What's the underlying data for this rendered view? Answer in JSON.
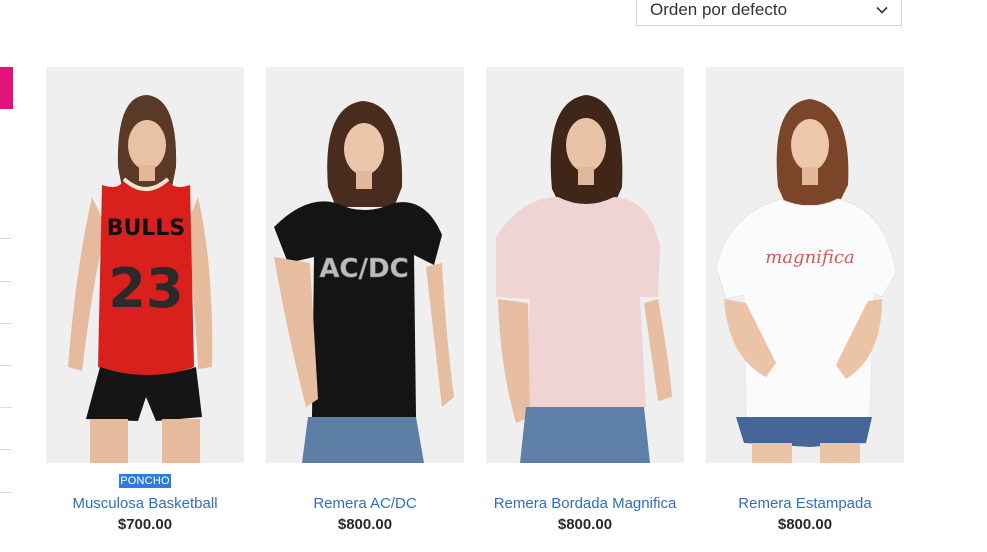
{
  "sort": {
    "selected": "Orden por defecto"
  },
  "colors": {
    "accent": "#e1127a",
    "link": "#2f6fbf",
    "highlight": "#2f7ce0"
  },
  "products": [
    {
      "category": "PONCHO",
      "name": "Musculosa Basketball",
      "price": "$700.00",
      "print_line1": "BULLS",
      "print_line2": "23"
    },
    {
      "category": "",
      "name": "Remera AC/DC",
      "price": "$800.00",
      "print": "AC/DC"
    },
    {
      "category": "",
      "name": "Remera Bordada Magnifica",
      "price": "$800.00"
    },
    {
      "category": "",
      "name": "Remera Estampada",
      "price": "$800.00",
      "print": "magnifica"
    }
  ]
}
